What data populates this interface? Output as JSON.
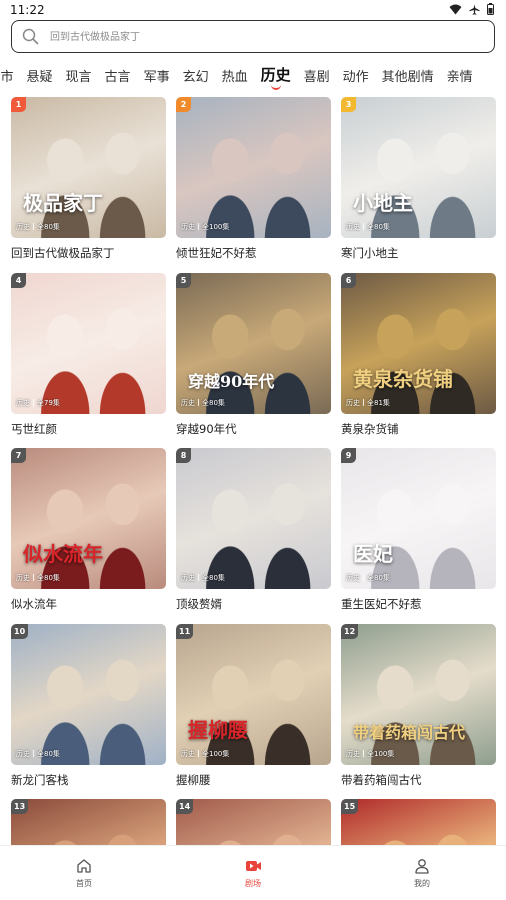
{
  "status_bar": {
    "time": "11:22"
  },
  "search": {
    "placeholder": "回到古代做极品家丁"
  },
  "categories": [
    {
      "label": "市"
    },
    {
      "label": "悬疑"
    },
    {
      "label": "现言"
    },
    {
      "label": "古言"
    },
    {
      "label": "军事"
    },
    {
      "label": "玄幻"
    },
    {
      "label": "热血"
    },
    {
      "label": "历史",
      "active": true
    },
    {
      "label": "喜剧"
    },
    {
      "label": "动作"
    },
    {
      "label": "其他剧情"
    },
    {
      "label": "亲情"
    }
  ],
  "dramas": [
    {
      "rank": "1",
      "title": "回到古代做极品家丁",
      "genre": "历史",
      "episodes": "全80集",
      "poster_text": "极品家丁"
    },
    {
      "rank": "2",
      "title": "倾世狂妃不好惹",
      "genre": "历史",
      "episodes": "全100集",
      "poster_text": ""
    },
    {
      "rank": "3",
      "title": "寒门小地主",
      "genre": "历史",
      "episodes": "全80集",
      "poster_text": "小地主"
    },
    {
      "rank": "4",
      "title": "丐世红颜",
      "genre": "历史",
      "episodes": "全79集",
      "poster_text": ""
    },
    {
      "rank": "5",
      "title": "穿越90年代",
      "genre": "历史",
      "episodes": "全80集",
      "poster_text": "穿越90年代"
    },
    {
      "rank": "6",
      "title": "黄泉杂货铺",
      "genre": "历史",
      "episodes": "全81集",
      "poster_text": "黄泉杂货铺"
    },
    {
      "rank": "7",
      "title": "似水流年",
      "genre": "历史",
      "episodes": "全80集",
      "poster_text": "似水流年"
    },
    {
      "rank": "8",
      "title": "顶级赘婿",
      "genre": "历史",
      "episodes": "全80集",
      "poster_text": ""
    },
    {
      "rank": "9",
      "title": "重生医妃不好惹",
      "genre": "历史",
      "episodes": "全80集",
      "poster_text": "医妃"
    },
    {
      "rank": "10",
      "title": "新龙门客栈",
      "genre": "历史",
      "episodes": "全80集",
      "poster_text": ""
    },
    {
      "rank": "11",
      "title": "握柳腰",
      "genre": "历史",
      "episodes": "全100集",
      "poster_text": "握柳腰"
    },
    {
      "rank": "12",
      "title": "带着药箱闯古代",
      "genre": "历史",
      "episodes": "全100集",
      "poster_text": "带着药箱闯古代"
    },
    {
      "rank": "13",
      "title": "",
      "genre": "",
      "episodes": "",
      "poster_text": ""
    },
    {
      "rank": "14",
      "title": "",
      "genre": "",
      "episodes": "",
      "poster_text": ""
    },
    {
      "rank": "15",
      "title": "",
      "genre": "",
      "episodes": "",
      "poster_text": ""
    }
  ],
  "bottom_nav": [
    {
      "label": "首页",
      "icon": "home-icon",
      "active": false
    },
    {
      "label": "剧场",
      "icon": "video-icon",
      "active": true
    },
    {
      "label": "我的",
      "icon": "user-icon",
      "active": false
    }
  ],
  "colors": {
    "accent": "#e8443a",
    "rank_top": "#f05a3a",
    "rank_second": "#f08a2a",
    "rank_third": "#f2b830",
    "rank_other": "#555555"
  }
}
